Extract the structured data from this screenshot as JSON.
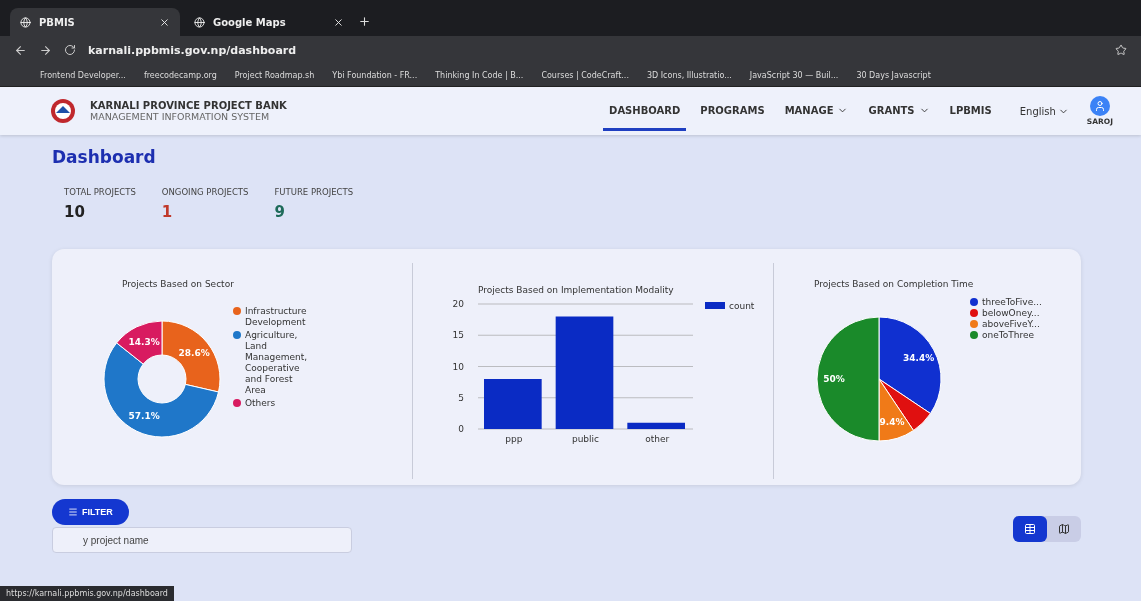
{
  "browser": {
    "tabs": [
      {
        "title": "PBMIS",
        "selected": true
      },
      {
        "title": "Google Maps",
        "selected": false
      }
    ],
    "address": "karnali.ppbmis.gov.np/dashboard",
    "bookmarks": [
      "Frontend Developer...",
      "freecodecamp.org",
      "Project Roadmap.sh",
      "Ybi Foundation - FR...",
      "Thinking In Code | B...",
      "Courses | CodeCraft...",
      "3D Icons, Illustratio...",
      "JavaScript 30 — Buil...",
      "30 Days Javascript"
    ],
    "status_url": "https://karnali.ppbmis.gov.np/dashboard"
  },
  "header": {
    "title": "KARNALI PROVINCE PROJECT BANK",
    "subtitle": "MANAGEMENT INFORMATION SYSTEM",
    "nav": [
      {
        "label": "DASHBOARD",
        "selected": true,
        "dropdown": false
      },
      {
        "label": "PROGRAMS",
        "selected": false,
        "dropdown": false
      },
      {
        "label": "MANAGE",
        "selected": false,
        "dropdown": true
      },
      {
        "label": "GRANTS",
        "selected": false,
        "dropdown": true
      },
      {
        "label": "LPBMIS",
        "selected": false,
        "dropdown": false
      }
    ],
    "language": "English",
    "user": "SAROJ"
  },
  "page_title": "Dashboard",
  "stats": [
    {
      "label": "TOTAL PROJECTS",
      "value": "10",
      "color": "#222222"
    },
    {
      "label": "ONGOING PROJECTS",
      "value": "1",
      "color": "#c0392b"
    },
    {
      "label": "FUTURE PROJECTS",
      "value": "9",
      "color": "#1e6b5a"
    }
  ],
  "charts": [
    {
      "chart_data": {
        "type": "donut",
        "title": "Projects Based on Sector",
        "categories": [
          "Infrastructure Development",
          "Agriculture, Land Management, Cooperative and Forest Area",
          "Others"
        ],
        "values": [
          28.6,
          57.1,
          14.3
        ],
        "colors": [
          "#e8631c",
          "#1f77c9",
          "#d81b60"
        ],
        "value_labels": [
          "28.6%",
          "57.1%",
          "14.3%"
        ],
        "legend": "right"
      }
    },
    {
      "chart_data": {
        "type": "bar",
        "title": "Projects Based on Implementation Modality",
        "categories": [
          "ppp",
          "public",
          "other"
        ],
        "series": [
          {
            "name": "count",
            "color": "#0a2bc4",
            "values": [
              8,
              18,
              1
            ]
          }
        ],
        "ylim": [
          0,
          20
        ],
        "yticks": [
          0,
          5,
          10,
          15,
          20
        ],
        "grid": true,
        "legend": "right"
      }
    },
    {
      "chart_data": {
        "type": "pie",
        "title": "Projects Based on Completion Time",
        "categories": [
          "threeToFive...",
          "belowOney...",
          "aboveFiveY...",
          "oneToThree"
        ],
        "values": [
          34.4,
          6.2,
          9.4,
          50
        ],
        "colors": [
          "#1030d0",
          "#e01010",
          "#f07a18",
          "#1a8a2a"
        ],
        "value_labels": [
          "34.4%",
          null,
          "9.4%",
          "50%"
        ],
        "legend": "right"
      }
    }
  ],
  "filter_button": "FILTER",
  "search": {
    "placeholder": "y project name"
  },
  "view_toggle": [
    {
      "kind": "table",
      "selected": true
    },
    {
      "kind": "map",
      "selected": false
    }
  ]
}
